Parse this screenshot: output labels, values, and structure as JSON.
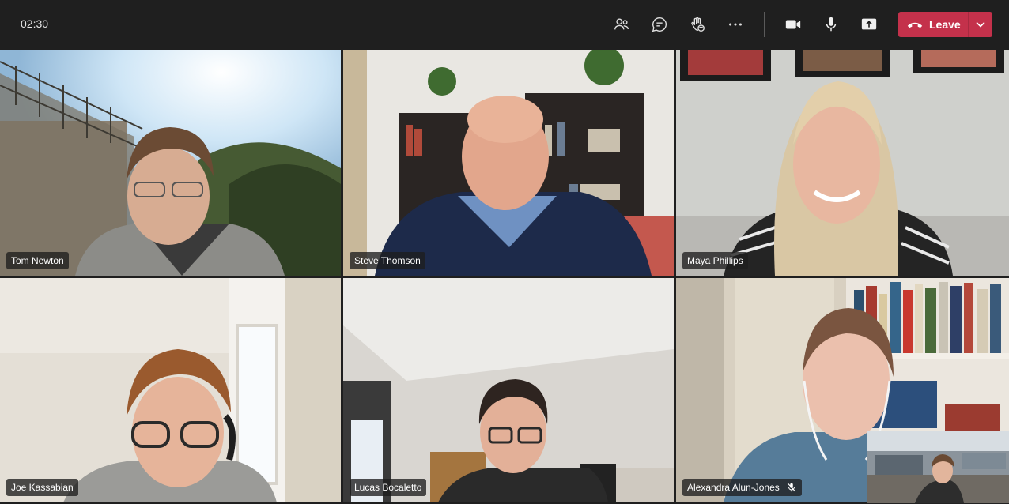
{
  "meeting": {
    "timer": "02:30",
    "leave_label": "Leave"
  },
  "toolbar": {
    "icons": [
      "participants-icon",
      "chat-icon",
      "reactions-icon",
      "more-options-icon",
      "camera-icon",
      "microphone-icon",
      "share-screen-icon"
    ]
  },
  "colors": {
    "toolbar_bg": "#1f1f1f",
    "leave_bg": "#c4314b",
    "nametag_bg": "#1e1e1e"
  },
  "participants": [
    {
      "name": "Tom Newton",
      "muted": false
    },
    {
      "name": "Steve Thomson",
      "muted": false
    },
    {
      "name": "Maya Phillips",
      "muted": false
    },
    {
      "name": "Joe Kassabian",
      "muted": false
    },
    {
      "name": "Lucas Bocaletto",
      "muted": false
    },
    {
      "name": "Alexandra Alun-Jones",
      "muted": true
    }
  ]
}
